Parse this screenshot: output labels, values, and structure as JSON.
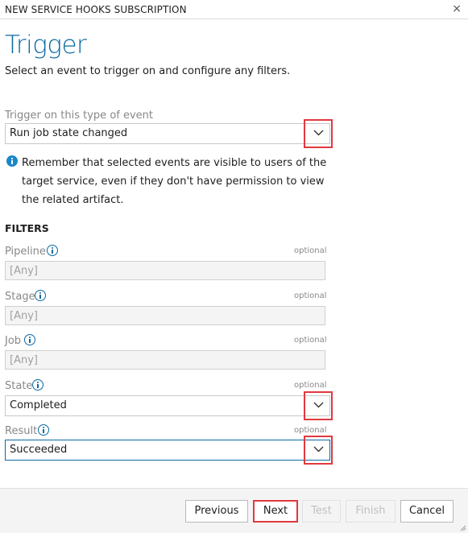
{
  "window": {
    "title": "NEW SERVICE HOOKS SUBSCRIPTION",
    "close_glyph": "×"
  },
  "header": {
    "title": "Trigger",
    "subtitle": "Select an event to trigger on and configure any filters."
  },
  "event": {
    "label": "Trigger on this type of event",
    "value": "Run job state changed"
  },
  "notice": "Remember that selected events are visible to users of the target service, even if they don't have permission to view the related artifact.",
  "filters": {
    "heading": "FILTERS",
    "optional_label": "optional",
    "pipeline": {
      "label": "Pipeline",
      "value": "[Any]"
    },
    "stage": {
      "label": "Stage",
      "value": "[Any]"
    },
    "job": {
      "label": "Job",
      "value": "[Any]"
    },
    "state": {
      "label": "State",
      "value": "Completed"
    },
    "result": {
      "label": "Result",
      "value": "Succeeded"
    }
  },
  "footer": {
    "previous": "Previous",
    "next": "Next",
    "test": "Test",
    "finish": "Finish",
    "cancel": "Cancel"
  },
  "colors": {
    "accent": "#0b6aa2",
    "highlight": "#e0393e",
    "info": "#1a87c9"
  }
}
